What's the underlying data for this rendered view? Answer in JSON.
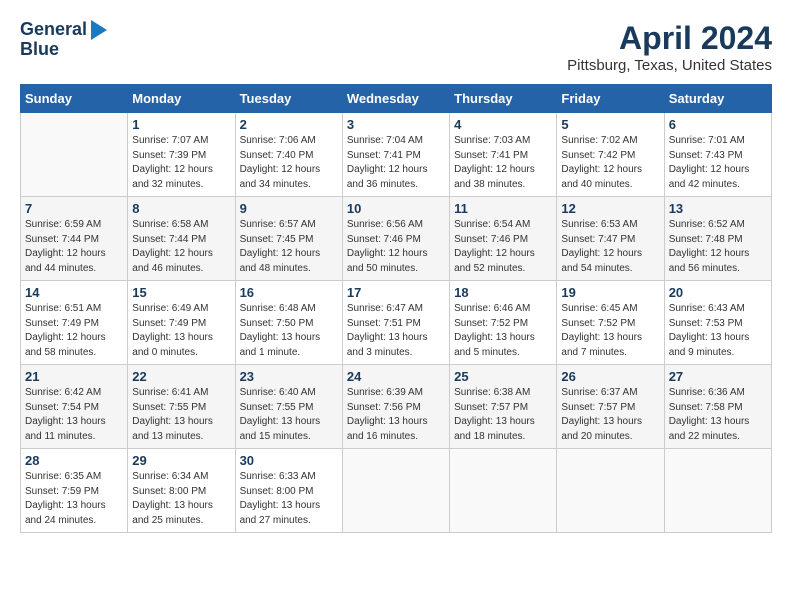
{
  "header": {
    "logo_line1": "General",
    "logo_line2": "Blue",
    "title": "April 2024",
    "subtitle": "Pittsburg, Texas, United States"
  },
  "days_of_week": [
    "Sunday",
    "Monday",
    "Tuesday",
    "Wednesday",
    "Thursday",
    "Friday",
    "Saturday"
  ],
  "weeks": [
    [
      {
        "day": "",
        "info": ""
      },
      {
        "day": "1",
        "info": "Sunrise: 7:07 AM\nSunset: 7:39 PM\nDaylight: 12 hours\nand 32 minutes."
      },
      {
        "day": "2",
        "info": "Sunrise: 7:06 AM\nSunset: 7:40 PM\nDaylight: 12 hours\nand 34 minutes."
      },
      {
        "day": "3",
        "info": "Sunrise: 7:04 AM\nSunset: 7:41 PM\nDaylight: 12 hours\nand 36 minutes."
      },
      {
        "day": "4",
        "info": "Sunrise: 7:03 AM\nSunset: 7:41 PM\nDaylight: 12 hours\nand 38 minutes."
      },
      {
        "day": "5",
        "info": "Sunrise: 7:02 AM\nSunset: 7:42 PM\nDaylight: 12 hours\nand 40 minutes."
      },
      {
        "day": "6",
        "info": "Sunrise: 7:01 AM\nSunset: 7:43 PM\nDaylight: 12 hours\nand 42 minutes."
      }
    ],
    [
      {
        "day": "7",
        "info": "Sunrise: 6:59 AM\nSunset: 7:44 PM\nDaylight: 12 hours\nand 44 minutes."
      },
      {
        "day": "8",
        "info": "Sunrise: 6:58 AM\nSunset: 7:44 PM\nDaylight: 12 hours\nand 46 minutes."
      },
      {
        "day": "9",
        "info": "Sunrise: 6:57 AM\nSunset: 7:45 PM\nDaylight: 12 hours\nand 48 minutes."
      },
      {
        "day": "10",
        "info": "Sunrise: 6:56 AM\nSunset: 7:46 PM\nDaylight: 12 hours\nand 50 minutes."
      },
      {
        "day": "11",
        "info": "Sunrise: 6:54 AM\nSunset: 7:46 PM\nDaylight: 12 hours\nand 52 minutes."
      },
      {
        "day": "12",
        "info": "Sunrise: 6:53 AM\nSunset: 7:47 PM\nDaylight: 12 hours\nand 54 minutes."
      },
      {
        "day": "13",
        "info": "Sunrise: 6:52 AM\nSunset: 7:48 PM\nDaylight: 12 hours\nand 56 minutes."
      }
    ],
    [
      {
        "day": "14",
        "info": "Sunrise: 6:51 AM\nSunset: 7:49 PM\nDaylight: 12 hours\nand 58 minutes."
      },
      {
        "day": "15",
        "info": "Sunrise: 6:49 AM\nSunset: 7:49 PM\nDaylight: 13 hours\nand 0 minutes."
      },
      {
        "day": "16",
        "info": "Sunrise: 6:48 AM\nSunset: 7:50 PM\nDaylight: 13 hours\nand 1 minute."
      },
      {
        "day": "17",
        "info": "Sunrise: 6:47 AM\nSunset: 7:51 PM\nDaylight: 13 hours\nand 3 minutes."
      },
      {
        "day": "18",
        "info": "Sunrise: 6:46 AM\nSunset: 7:52 PM\nDaylight: 13 hours\nand 5 minutes."
      },
      {
        "day": "19",
        "info": "Sunrise: 6:45 AM\nSunset: 7:52 PM\nDaylight: 13 hours\nand 7 minutes."
      },
      {
        "day": "20",
        "info": "Sunrise: 6:43 AM\nSunset: 7:53 PM\nDaylight: 13 hours\nand 9 minutes."
      }
    ],
    [
      {
        "day": "21",
        "info": "Sunrise: 6:42 AM\nSunset: 7:54 PM\nDaylight: 13 hours\nand 11 minutes."
      },
      {
        "day": "22",
        "info": "Sunrise: 6:41 AM\nSunset: 7:55 PM\nDaylight: 13 hours\nand 13 minutes."
      },
      {
        "day": "23",
        "info": "Sunrise: 6:40 AM\nSunset: 7:55 PM\nDaylight: 13 hours\nand 15 minutes."
      },
      {
        "day": "24",
        "info": "Sunrise: 6:39 AM\nSunset: 7:56 PM\nDaylight: 13 hours\nand 16 minutes."
      },
      {
        "day": "25",
        "info": "Sunrise: 6:38 AM\nSunset: 7:57 PM\nDaylight: 13 hours\nand 18 minutes."
      },
      {
        "day": "26",
        "info": "Sunrise: 6:37 AM\nSunset: 7:57 PM\nDaylight: 13 hours\nand 20 minutes."
      },
      {
        "day": "27",
        "info": "Sunrise: 6:36 AM\nSunset: 7:58 PM\nDaylight: 13 hours\nand 22 minutes."
      }
    ],
    [
      {
        "day": "28",
        "info": "Sunrise: 6:35 AM\nSunset: 7:59 PM\nDaylight: 13 hours\nand 24 minutes."
      },
      {
        "day": "29",
        "info": "Sunrise: 6:34 AM\nSunset: 8:00 PM\nDaylight: 13 hours\nand 25 minutes."
      },
      {
        "day": "30",
        "info": "Sunrise: 6:33 AM\nSunset: 8:00 PM\nDaylight: 13 hours\nand 27 minutes."
      },
      {
        "day": "",
        "info": ""
      },
      {
        "day": "",
        "info": ""
      },
      {
        "day": "",
        "info": ""
      },
      {
        "day": "",
        "info": ""
      }
    ]
  ]
}
